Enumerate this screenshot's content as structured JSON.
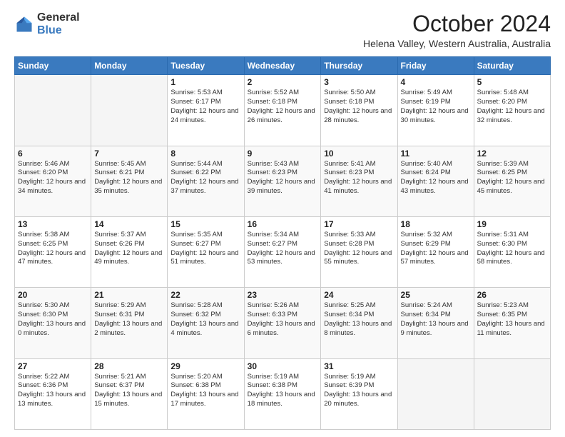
{
  "logo": {
    "general": "General",
    "blue": "Blue"
  },
  "header": {
    "month_year": "October 2024",
    "location": "Helena Valley, Western Australia, Australia"
  },
  "weekdays": [
    "Sunday",
    "Monday",
    "Tuesday",
    "Wednesday",
    "Thursday",
    "Friday",
    "Saturday"
  ],
  "weeks": [
    [
      {
        "day": "",
        "info": ""
      },
      {
        "day": "",
        "info": ""
      },
      {
        "day": "1",
        "info": "Sunrise: 5:53 AM\nSunset: 6:17 PM\nDaylight: 12 hours and 24 minutes."
      },
      {
        "day": "2",
        "info": "Sunrise: 5:52 AM\nSunset: 6:18 PM\nDaylight: 12 hours and 26 minutes."
      },
      {
        "day": "3",
        "info": "Sunrise: 5:50 AM\nSunset: 6:18 PM\nDaylight: 12 hours and 28 minutes."
      },
      {
        "day": "4",
        "info": "Sunrise: 5:49 AM\nSunset: 6:19 PM\nDaylight: 12 hours and 30 minutes."
      },
      {
        "day": "5",
        "info": "Sunrise: 5:48 AM\nSunset: 6:20 PM\nDaylight: 12 hours and 32 minutes."
      }
    ],
    [
      {
        "day": "6",
        "info": "Sunrise: 5:46 AM\nSunset: 6:20 PM\nDaylight: 12 hours and 34 minutes."
      },
      {
        "day": "7",
        "info": "Sunrise: 5:45 AM\nSunset: 6:21 PM\nDaylight: 12 hours and 35 minutes."
      },
      {
        "day": "8",
        "info": "Sunrise: 5:44 AM\nSunset: 6:22 PM\nDaylight: 12 hours and 37 minutes."
      },
      {
        "day": "9",
        "info": "Sunrise: 5:43 AM\nSunset: 6:23 PM\nDaylight: 12 hours and 39 minutes."
      },
      {
        "day": "10",
        "info": "Sunrise: 5:41 AM\nSunset: 6:23 PM\nDaylight: 12 hours and 41 minutes."
      },
      {
        "day": "11",
        "info": "Sunrise: 5:40 AM\nSunset: 6:24 PM\nDaylight: 12 hours and 43 minutes."
      },
      {
        "day": "12",
        "info": "Sunrise: 5:39 AM\nSunset: 6:25 PM\nDaylight: 12 hours and 45 minutes."
      }
    ],
    [
      {
        "day": "13",
        "info": "Sunrise: 5:38 AM\nSunset: 6:25 PM\nDaylight: 12 hours and 47 minutes."
      },
      {
        "day": "14",
        "info": "Sunrise: 5:37 AM\nSunset: 6:26 PM\nDaylight: 12 hours and 49 minutes."
      },
      {
        "day": "15",
        "info": "Sunrise: 5:35 AM\nSunset: 6:27 PM\nDaylight: 12 hours and 51 minutes."
      },
      {
        "day": "16",
        "info": "Sunrise: 5:34 AM\nSunset: 6:27 PM\nDaylight: 12 hours and 53 minutes."
      },
      {
        "day": "17",
        "info": "Sunrise: 5:33 AM\nSunset: 6:28 PM\nDaylight: 12 hours and 55 minutes."
      },
      {
        "day": "18",
        "info": "Sunrise: 5:32 AM\nSunset: 6:29 PM\nDaylight: 12 hours and 57 minutes."
      },
      {
        "day": "19",
        "info": "Sunrise: 5:31 AM\nSunset: 6:30 PM\nDaylight: 12 hours and 58 minutes."
      }
    ],
    [
      {
        "day": "20",
        "info": "Sunrise: 5:30 AM\nSunset: 6:30 PM\nDaylight: 13 hours and 0 minutes."
      },
      {
        "day": "21",
        "info": "Sunrise: 5:29 AM\nSunset: 6:31 PM\nDaylight: 13 hours and 2 minutes."
      },
      {
        "day": "22",
        "info": "Sunrise: 5:28 AM\nSunset: 6:32 PM\nDaylight: 13 hours and 4 minutes."
      },
      {
        "day": "23",
        "info": "Sunrise: 5:26 AM\nSunset: 6:33 PM\nDaylight: 13 hours and 6 minutes."
      },
      {
        "day": "24",
        "info": "Sunrise: 5:25 AM\nSunset: 6:34 PM\nDaylight: 13 hours and 8 minutes."
      },
      {
        "day": "25",
        "info": "Sunrise: 5:24 AM\nSunset: 6:34 PM\nDaylight: 13 hours and 9 minutes."
      },
      {
        "day": "26",
        "info": "Sunrise: 5:23 AM\nSunset: 6:35 PM\nDaylight: 13 hours and 11 minutes."
      }
    ],
    [
      {
        "day": "27",
        "info": "Sunrise: 5:22 AM\nSunset: 6:36 PM\nDaylight: 13 hours and 13 minutes."
      },
      {
        "day": "28",
        "info": "Sunrise: 5:21 AM\nSunset: 6:37 PM\nDaylight: 13 hours and 15 minutes."
      },
      {
        "day": "29",
        "info": "Sunrise: 5:20 AM\nSunset: 6:38 PM\nDaylight: 13 hours and 17 minutes."
      },
      {
        "day": "30",
        "info": "Sunrise: 5:19 AM\nSunset: 6:38 PM\nDaylight: 13 hours and 18 minutes."
      },
      {
        "day": "31",
        "info": "Sunrise: 5:19 AM\nSunset: 6:39 PM\nDaylight: 13 hours and 20 minutes."
      },
      {
        "day": "",
        "info": ""
      },
      {
        "day": "",
        "info": ""
      }
    ]
  ]
}
